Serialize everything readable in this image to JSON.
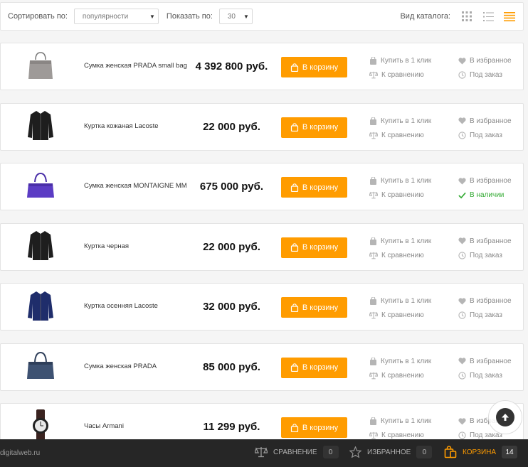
{
  "toolbar": {
    "sort_label": "Сортировать по:",
    "sort_value": "популярности",
    "show_label": "Показать по:",
    "show_value": "30",
    "view_label": "Вид каталога:"
  },
  "products": [
    {
      "name": "Сумка женская PRADA small bag",
      "price": "4 392 800 руб.",
      "cart": "В корзину",
      "buy1": "Купить в 1 клик",
      "compare": "К сравнению",
      "fav": "В избранное",
      "avail": "Под заказ",
      "in_stock": false,
      "image": "grey-bag-icon"
    },
    {
      "name": "Куртка кожаная Lacoste",
      "price": "22 000 руб.",
      "cart": "В корзину",
      "buy1": "Купить в 1 клик",
      "compare": "К сравнению",
      "fav": "В избранное",
      "avail": "Под заказ",
      "in_stock": false,
      "image": "black-jacket-icon"
    },
    {
      "name": "Сумка женская MONTAIGNE MM",
      "price": "675 000 руб.",
      "cart": "В корзину",
      "buy1": "Купить в 1 клик",
      "compare": "К сравнению",
      "fav": "В избранное",
      "avail": "В наличии",
      "in_stock": true,
      "image": "purple-bag-icon"
    },
    {
      "name": "Куртка черная",
      "price": "22 000 руб.",
      "cart": "В корзину",
      "buy1": "Купить в 1 клик",
      "compare": "К сравнению",
      "fav": "В избранное",
      "avail": "Под заказ",
      "in_stock": false,
      "image": "black-jacket-icon"
    },
    {
      "name": "Куртка осенняя Lacoste",
      "price": "32 000 руб.",
      "cart": "В корзину",
      "buy1": "Купить в 1 клик",
      "compare": "К сравнению",
      "fav": "В избранное",
      "avail": "Под заказ",
      "in_stock": false,
      "image": "blue-jacket-icon"
    },
    {
      "name": "Сумка женская PRADA",
      "price": "85 000 руб.",
      "cart": "В корзину",
      "buy1": "Купить в 1 клик",
      "compare": "К сравнению",
      "fav": "В избранное",
      "avail": "Под заказ",
      "in_stock": false,
      "image": "navy-bag-icon"
    },
    {
      "name": "Часы Armani",
      "price": "11 299 руб.",
      "cart": "В корзину",
      "buy1": "Купить в 1 клик",
      "compare": "К сравнению",
      "fav": "В избранное",
      "avail": "Под заказ",
      "in_stock": false,
      "image": "watch-icon"
    }
  ],
  "bottombar": {
    "site": "digitalweb.ru",
    "compare_label": "СРАВНЕНИЕ",
    "compare_count": "0",
    "fav_label": "ИЗБРАННОЕ",
    "fav_count": "0",
    "cart_label": "КОРЗИНА",
    "cart_count": "14"
  },
  "colors": {
    "accent": "#ff9c00",
    "in_stock": "#33aa33",
    "bottombar": "#262626"
  }
}
